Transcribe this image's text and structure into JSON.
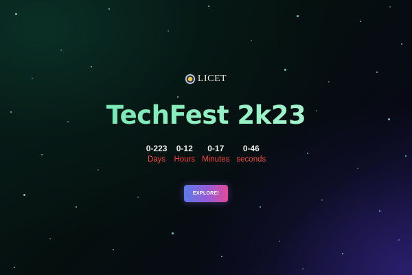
{
  "logo": {
    "text": "LICET",
    "icon": "college-emblem-icon"
  },
  "hero": {
    "title": "TechFest 2k23"
  },
  "countdown": {
    "days": {
      "value": "0-223",
      "label": "Days"
    },
    "hours": {
      "value": "0-12",
      "label": "Hours"
    },
    "minutes": {
      "value": "0-17",
      "label": "Minutes"
    },
    "seconds": {
      "value": "0-46",
      "label": "seconds"
    }
  },
  "cta": {
    "label": "EXPLORE!"
  },
  "colors": {
    "title_gradient_start": "#5ee0a6",
    "title_gradient_end": "#b8f7d6",
    "countdown_label": "#f0483f",
    "button_gradient_start": "#5b7be8",
    "button_gradient_end": "#e24a9a",
    "star": "#7fe3e9"
  }
}
